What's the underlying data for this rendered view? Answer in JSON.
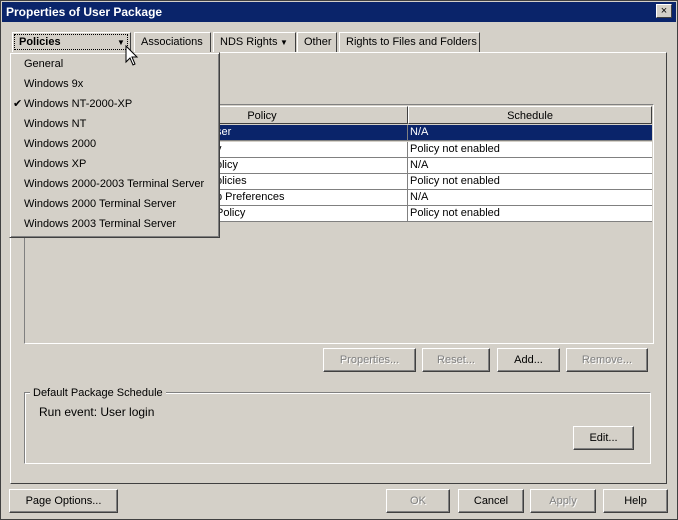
{
  "window": {
    "title": "Properties of User Package",
    "close_glyph": "×"
  },
  "tabs": [
    {
      "label": "Policies",
      "active": true
    },
    {
      "label": "Associations"
    },
    {
      "label": "NDS Rights"
    },
    {
      "label": "Other"
    },
    {
      "label": "Rights to Files and Folders"
    }
  ],
  "dropdown_menu": {
    "items": [
      {
        "label": "General",
        "checked": false
      },
      {
        "label": "Windows 9x",
        "checked": false
      },
      {
        "label": "Windows NT-2000-XP",
        "checked": true
      },
      {
        "label": "Windows NT",
        "checked": false
      },
      {
        "label": "Windows 2000",
        "checked": false
      },
      {
        "label": "Windows XP",
        "checked": false
      },
      {
        "label": "Windows 2000-2003 Terminal Server",
        "checked": false
      },
      {
        "label": "Windows 2000 Terminal Server",
        "checked": false
      },
      {
        "label": "Windows 2003 Terminal Server",
        "checked": false
      }
    ],
    "check_glyph": "✔"
  },
  "table": {
    "columns": [
      "Policy",
      "Schedule"
    ],
    "rows": [
      {
        "policy": "ser",
        "schedule": "N/A",
        "selected": true
      },
      {
        "policy": "y",
        "schedule": "Policy not enabled"
      },
      {
        "policy": "olicy",
        "schedule": "N/A"
      },
      {
        "policy": "olicies",
        "schedule": "Policy not enabled"
      },
      {
        "policy": "p Preferences",
        "schedule": "N/A"
      },
      {
        "policy": "Policy",
        "schedule": "Policy not enabled"
      }
    ]
  },
  "table_buttons": {
    "properties": "Properties...",
    "reset": "Reset...",
    "add": "Add...",
    "remove": "Remove..."
  },
  "schedule_group": {
    "label": "Default Package Schedule",
    "text": "Run event: User login",
    "edit": "Edit..."
  },
  "footer": {
    "page_options": "Page Options...",
    "ok": "OK",
    "cancel": "Cancel",
    "apply": "Apply",
    "help": "Help"
  },
  "colors": {
    "selection": "#0a246a",
    "face": "#d4d0c8"
  }
}
